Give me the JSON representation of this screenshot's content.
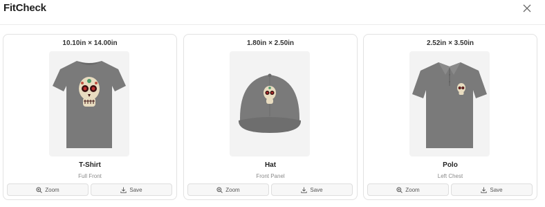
{
  "app": {
    "title": "FitCheck",
    "close_icon": "close-icon"
  },
  "colors": {
    "garment": "#7a7a7a",
    "preview_bg": "#f3f3f3"
  },
  "products": [
    {
      "dimensions": "10.10in × 14.00in",
      "name": "T-Shirt",
      "placement": "Full Front",
      "zoom_label": "Zoom",
      "save_label": "Save",
      "garment_icon": "tshirt-image"
    },
    {
      "dimensions": "1.80in × 2.50in",
      "name": "Hat",
      "placement": "Front Panel",
      "zoom_label": "Zoom",
      "save_label": "Save",
      "garment_icon": "hat-image"
    },
    {
      "dimensions": "2.52in × 3.50in",
      "name": "Polo",
      "placement": "Left Chest",
      "zoom_label": "Zoom",
      "save_label": "Save",
      "garment_icon": "polo-image"
    }
  ]
}
